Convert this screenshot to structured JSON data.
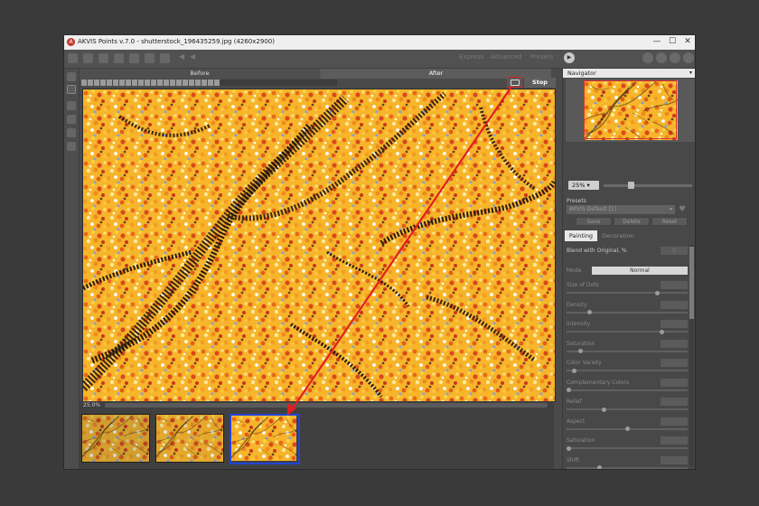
{
  "window": {
    "title": "AKVIS Points v.7.0 - shutterstock_196435259.jpg (4260x2900)",
    "logo": "A",
    "controls": {
      "minimize": "—",
      "maximize": "☐",
      "close": "✕"
    }
  },
  "toolbar": {
    "modes": [
      "Express",
      "Advanced",
      "Presets"
    ],
    "play_icon": "▶",
    "undo_icon": "◀",
    "redo_icon": "◀"
  },
  "view_tabs": {
    "before": "Before",
    "after": "After"
  },
  "processing": {
    "stop_label": "Stop",
    "progress": 0.54
  },
  "zoom": {
    "status": "25.0%",
    "selected": "25% ▾",
    "slider_value": 0.3
  },
  "navigator": {
    "title": "Navigator",
    "chevron": "▾"
  },
  "presets": {
    "label": "Presets",
    "selected": "AKVIS Default [1]",
    "chevron": "▾",
    "heart_icon": "♥",
    "buttons": [
      "Save",
      "Delete",
      "Reset"
    ]
  },
  "settings_tabs": {
    "active": "Painting",
    "inactive": "Decoration"
  },
  "params": {
    "blend": {
      "label": "Blend with Original, %",
      "value": "0"
    },
    "mode": {
      "label": "Mode",
      "value": "Normal"
    },
    "sliders": [
      {
        "label": "Size of Dots",
        "value": "",
        "level": 0.76
      },
      {
        "label": "Density",
        "value": "",
        "level": 0.18
      },
      {
        "label": "Intensity",
        "value": "",
        "level": 0.8
      },
      {
        "label": "Saturation",
        "value": "",
        "level": 0.1
      },
      {
        "label": "Color Variety",
        "value": "",
        "level": 0.05
      },
      {
        "label": "Complementary Colors",
        "value": "",
        "level": 0.0
      },
      {
        "label": "Relief",
        "value": "",
        "level": 0.3
      },
      {
        "label": "Aspect",
        "value": "",
        "level": 0.5
      },
      {
        "label": "Saturation",
        "value": "",
        "level": 0.0
      },
      {
        "label": "Shift",
        "value": "",
        "level": 0.26
      },
      {
        "label": "Alignment",
        "value": "",
        "level": 0.5
      },
      {
        "label": "Tilt",
        "value": "",
        "level": 0.0
      }
    ]
  },
  "colors": {
    "accent_red": "#e02020",
    "selection_blue": "#2244dd",
    "autumn_orange": "#f0a020",
    "branch_dark": "#3a2414"
  }
}
